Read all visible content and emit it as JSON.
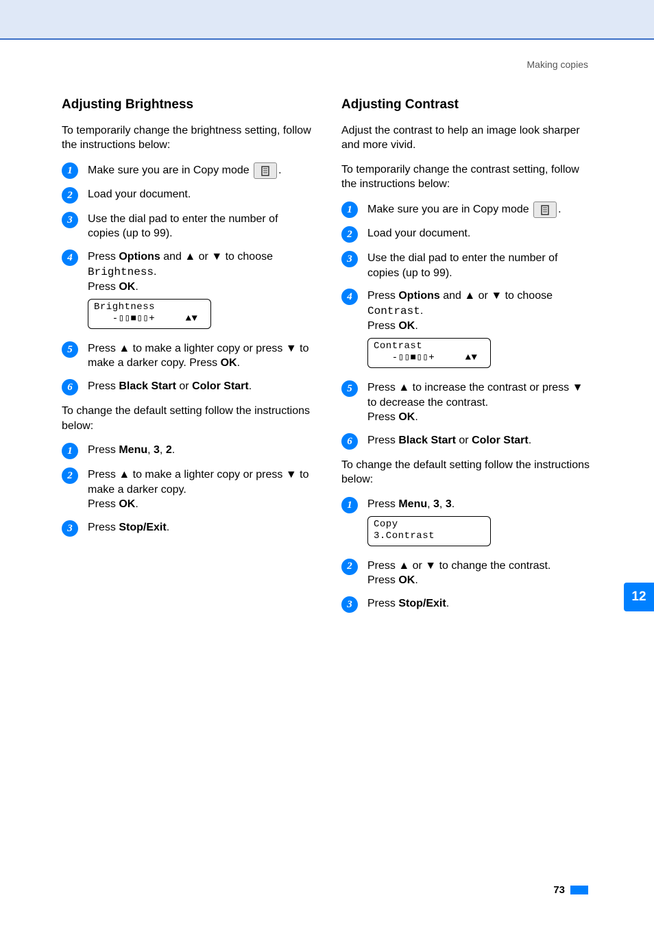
{
  "breadcrumb": "Making copies",
  "page_number": "73",
  "chapter_tab": "12",
  "left": {
    "heading": "Adjusting Brightness",
    "intro": "To temporarily change the brightness setting, follow the instructions below:",
    "steps": [
      {
        "n": "1",
        "pre": "Make sure you are in Copy mode ",
        "post": "."
      },
      {
        "n": "2",
        "text": "Load your document."
      },
      {
        "n": "3",
        "text": "Use the dial pad to enter the number of copies (up to 99)."
      },
      {
        "n": "4",
        "seg1a": "Press ",
        "seg1b": "Options",
        "seg1c": " and ▲ or ▼ to choose ",
        "seg2": "Brightness",
        "seg2p": ".",
        "seg3a": "Press ",
        "seg3b": "OK",
        "seg3c": ".",
        "lcd1": "Brightness",
        "lcd2": "   -▯▯■▯▯+     ▲▼"
      },
      {
        "n": "5",
        "a": "Press ▲ to make a lighter copy or press ▼ to make a darker copy. Press ",
        "b": "OK",
        "c": "."
      },
      {
        "n": "6",
        "a": "Press ",
        "b": "Black Start",
        "c": " or ",
        "d": "Color Start",
        "e": "."
      }
    ],
    "mid": "To change the default setting follow the instructions below:",
    "steps2": [
      {
        "n": "1",
        "a": "Press ",
        "b": "Menu",
        "c": ", ",
        "d": "3",
        "e": ", ",
        "f": "2",
        "g": "."
      },
      {
        "n": "2",
        "line1": "Press ▲ to make a lighter copy or press ▼ to make a darker copy.",
        "line2a": "Press ",
        "line2b": "OK",
        "line2c": "."
      },
      {
        "n": "3",
        "a": "Press ",
        "b": "Stop/Exit",
        "c": "."
      }
    ]
  },
  "right": {
    "heading": "Adjusting Contrast",
    "intro1": "Adjust the contrast to help an image look sharper and more vivid.",
    "intro2": "To temporarily change the contrast setting, follow the instructions below:",
    "steps": [
      {
        "n": "1",
        "pre": "Make sure you are in Copy mode ",
        "post": "."
      },
      {
        "n": "2",
        "text": "Load your document."
      },
      {
        "n": "3",
        "text": "Use the dial pad to enter the number of copies (up to 99)."
      },
      {
        "n": "4",
        "seg1a": "Press ",
        "seg1b": "Options",
        "seg1c": " and ▲ or ▼ to choose ",
        "seg2": "Contrast",
        "seg2p": ".",
        "seg3a": "Press ",
        "seg3b": "OK",
        "seg3c": ".",
        "lcd1": "Contrast",
        "lcd2": "   -▯▯■▯▯+     ▲▼"
      },
      {
        "n": "5",
        "line1": "Press ▲ to increase the contrast or press ▼ to decrease the contrast.",
        "line2a": "Press ",
        "line2b": "OK",
        "line2c": "."
      },
      {
        "n": "6",
        "a": "Press ",
        "b": "Black Start",
        "c": " or ",
        "d": "Color Start",
        "e": "."
      }
    ],
    "mid": "To change the default setting follow the instructions below:",
    "steps2": [
      {
        "n": "1",
        "a": "Press ",
        "b": "Menu",
        "c": ", ",
        "d": "3",
        "e": ", ",
        "f": "3",
        "g": ".",
        "lcd1": "Copy",
        "lcd2": "3.Contrast"
      },
      {
        "n": "2",
        "line1": "Press ▲ or ▼ to change the contrast.",
        "line2a": "Press ",
        "line2b": "OK",
        "line2c": "."
      },
      {
        "n": "3",
        "a": "Press ",
        "b": "Stop/Exit",
        "c": "."
      }
    ]
  }
}
